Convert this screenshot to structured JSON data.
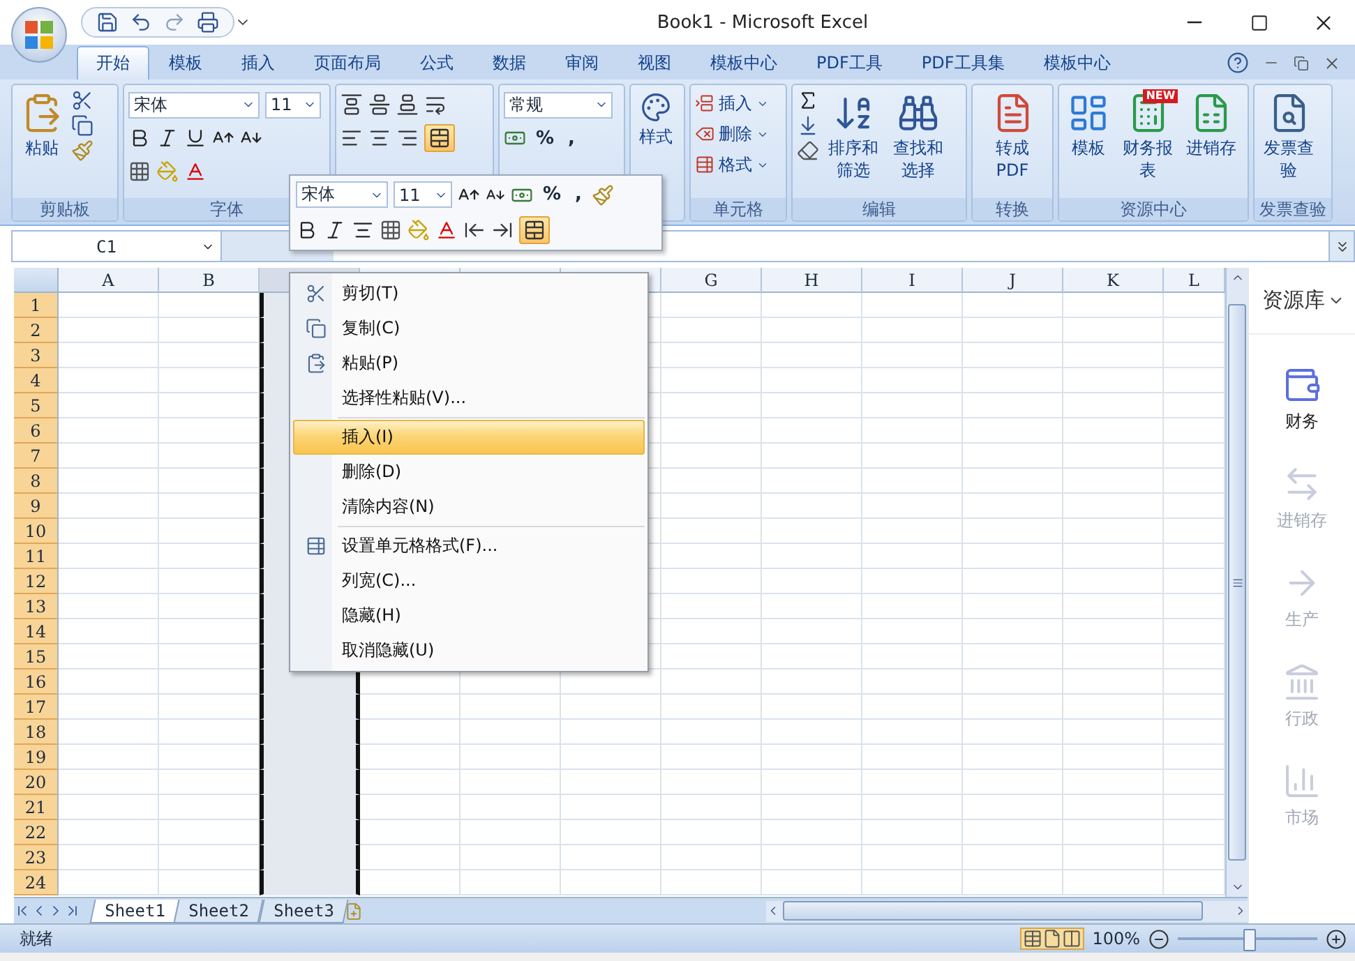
{
  "window": {
    "title": "Book1 - Microsoft Excel"
  },
  "tabs": [
    {
      "label": "开始",
      "selected": true
    },
    {
      "label": "模板",
      "selected": false
    },
    {
      "label": "插入",
      "selected": false
    },
    {
      "label": "页面布局",
      "selected": false
    },
    {
      "label": "公式",
      "selected": false
    },
    {
      "label": "数据",
      "selected": false
    },
    {
      "label": "审阅",
      "selected": false
    },
    {
      "label": "视图",
      "selected": false
    },
    {
      "label": "模板中心",
      "selected": false
    },
    {
      "label": "PDF工具",
      "selected": false
    },
    {
      "label": "PDF工具集",
      "selected": false
    },
    {
      "label": "模板中心",
      "selected": false
    }
  ],
  "ribbon": {
    "groups": [
      {
        "kind": "clipboard",
        "label": "剪贴板",
        "paste": "粘贴"
      },
      {
        "kind": "font",
        "label": "字体",
        "font": "宋体",
        "size": "11"
      },
      {
        "kind": "alignment"
      },
      {
        "kind": "number",
        "format": "常规",
        "percent": "%",
        "comma": ","
      },
      {
        "kind": "styles",
        "button": "样式"
      },
      {
        "kind": "cells",
        "label": "单元格",
        "items": [
          "插入",
          "删除",
          "格式"
        ]
      },
      {
        "kind": "editing",
        "label": "编辑",
        "buttons": [
          "排序和筛选",
          "查找和选择"
        ]
      },
      {
        "kind": "convert",
        "label": "转换",
        "buttons": [
          "转成PDF"
        ]
      },
      {
        "kind": "resources",
        "label": "资源中心",
        "buttons": [
          "模板",
          "财务报表",
          "进销存"
        ],
        "badge": "NEW"
      },
      {
        "kind": "invoice",
        "label": "发票查验",
        "buttons": [
          "发票查验"
        ]
      }
    ]
  },
  "mini_toolbar": {
    "font": "宋体",
    "size": "11",
    "percent": "%",
    "comma": ","
  },
  "name_box": "C1",
  "columns": [
    {
      "label": "A",
      "selected": false
    },
    {
      "label": "B",
      "selected": false
    },
    {
      "selected": true
    },
    {
      "selected": false
    },
    {
      "selected": false
    },
    {
      "selected": false
    },
    {
      "label": "G",
      "selected": false
    },
    {
      "label": "H",
      "selected": false
    },
    {
      "label": "I",
      "selected": false
    },
    {
      "label": "J",
      "selected": false
    },
    {
      "label": "K",
      "selected": false
    },
    {
      "label": "L",
      "selected": false
    }
  ],
  "rows": [
    "1",
    "2",
    "3",
    "4",
    "5",
    "6",
    "7",
    "8",
    "9",
    "10",
    "11",
    "12",
    "13",
    "14",
    "15",
    "16",
    "17",
    "18",
    "19",
    "20",
    "21",
    "22",
    "23",
    "24"
  ],
  "context_menu": {
    "items": [
      {
        "kind": "cut",
        "label": "剪切(T)",
        "selected": false
      },
      {
        "kind": "copy",
        "label": "复制(C)",
        "selected": false
      },
      {
        "kind": "paste",
        "label": "粘贴(P)",
        "selected": false
      },
      {
        "kind": "plain",
        "label": "选择性粘贴(V)...",
        "selected": false
      },
      {
        "kind": "separator"
      },
      {
        "kind": "plain",
        "label": "插入(I)",
        "selected": true
      },
      {
        "kind": "plain",
        "label": "删除(D)",
        "selected": false
      },
      {
        "kind": "plain",
        "label": "清除内容(N)",
        "selected": false
      },
      {
        "kind": "separator"
      },
      {
        "kind": "format",
        "label": "设置单元格格式(F)...",
        "selected": false
      },
      {
        "kind": "plain",
        "label": "列宽(C)...",
        "selected": false
      },
      {
        "kind": "plain",
        "label": "隐藏(H)",
        "selected": false
      },
      {
        "kind": "plain",
        "label": "取消隐藏(U)",
        "selected": false
      }
    ]
  },
  "sheet_tabs": [
    {
      "label": "Sheet1",
      "selected": true
    },
    {
      "label": "Sheet2",
      "selected": false
    },
    {
      "label": "Sheet3",
      "selected": false
    }
  ],
  "side_panel": {
    "title": "资源库",
    "items": [
      {
        "label": "财务",
        "selected": true
      },
      {
        "label": "进销存",
        "selected": false
      },
      {
        "label": "生产",
        "selected": false
      },
      {
        "label": "行政",
        "selected": false
      },
      {
        "label": "市场",
        "selected": false
      }
    ]
  },
  "status_bar": {
    "text": "就绪",
    "zoom": "100%",
    "zoom_slider": {
      "level": 0.5
    }
  }
}
